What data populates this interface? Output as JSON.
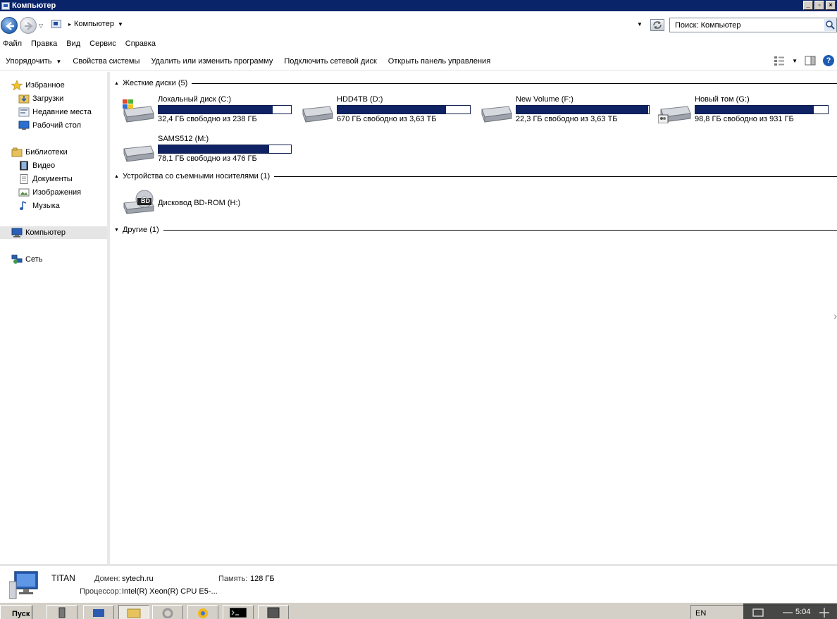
{
  "window": {
    "title": "Компьютер"
  },
  "address": {
    "crumb": "Компьютер",
    "search_placeholder": "Поиск: Компьютер"
  },
  "menu": [
    "Файл",
    "Правка",
    "Вид",
    "Сервис",
    "Справка"
  ],
  "commands": {
    "organize": "Упорядочить",
    "system_props": "Свойства системы",
    "uninstall": "Удалить или изменить программу",
    "map_drive": "Подключить сетевой диск",
    "control_panel": "Открыть панель управления"
  },
  "nav": {
    "favorites": "Избранное",
    "downloads": "Загрузки",
    "recent": "Недавние места",
    "desktop": "Рабочий стол",
    "libraries": "Библиотеки",
    "video": "Видео",
    "documents": "Документы",
    "images": "Изображения",
    "music": "Музыка",
    "computer": "Компьютер",
    "network": "Сеть"
  },
  "groups": {
    "hard_disks": "Жесткие диски (5)",
    "removable": "Устройства со съемными носителями (1)",
    "other": "Другие (1)"
  },
  "drives": [
    {
      "name": "Локальный диск (C:)",
      "free": "32,4 ГБ свободно из 238 ГБ",
      "used_fraction": 0.864,
      "icon": "windows-drive-icon"
    },
    {
      "name": "HDD4TB (D:)",
      "free": "670 ГБ свободно из 3,63 ТБ",
      "used_fraction": 0.82,
      "icon": "hard-drive-icon"
    },
    {
      "name": "New Volume (F:)",
      "free": "22,3 ГБ свободно из 3,63 ТБ",
      "used_fraction": 0.994,
      "icon": "hard-drive-icon"
    },
    {
      "name": "Новый том (G:)",
      "free": "98,8 ГБ свободно из 931 ГБ",
      "used_fraction": 0.894,
      "icon": "shared-drive-icon"
    },
    {
      "name": "SAMS512 (M:)",
      "free": "78,1 ГБ свободно из 476 ГБ",
      "used_fraction": 0.836,
      "icon": "hard-drive-icon"
    }
  ],
  "removable": {
    "name": "Дисковод BD-ROM (H:)",
    "badge": "BD"
  },
  "details": {
    "name": "TITAN",
    "domain_label": "Домен:",
    "domain": "sytech.ru",
    "memory_label": "Память:",
    "memory": "128 ГБ",
    "cpu_label": "Процессор:",
    "cpu": "Intel(R) Xeon(R) CPU E5-..."
  },
  "taskbar": {
    "start": "Пуск",
    "lang": "EN",
    "clock": "5:04"
  }
}
